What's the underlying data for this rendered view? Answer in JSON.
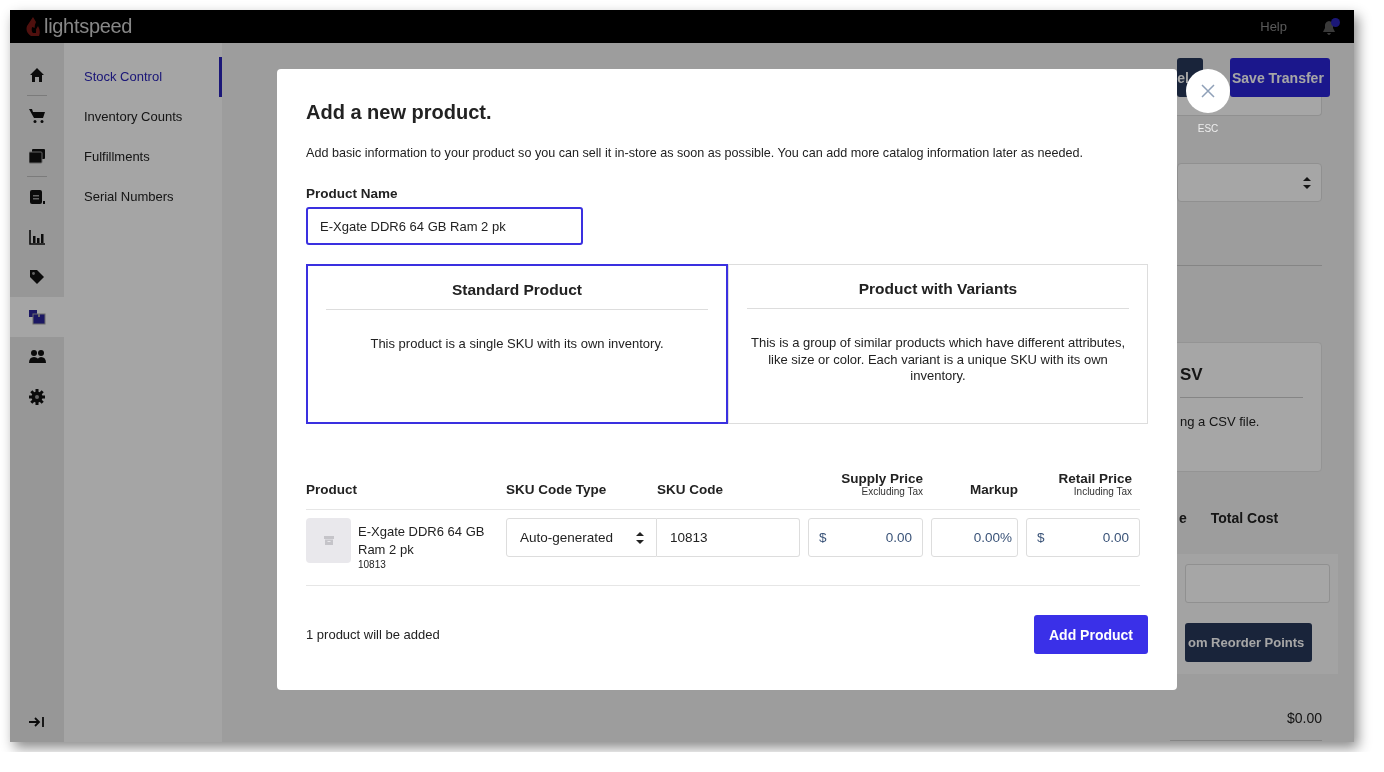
{
  "topbar": {
    "logo": "lightspeed",
    "help": "Help"
  },
  "rail": {
    "items": [
      {
        "selected": false
      },
      {
        "selected": false
      },
      {
        "selected": false
      },
      {
        "selected": false
      },
      {
        "selected": false
      },
      {
        "selected": false
      },
      {
        "selected": true
      },
      {
        "selected": false
      },
      {
        "selected": false
      }
    ]
  },
  "submenu": [
    {
      "label": "Stock Control",
      "selected": true
    },
    {
      "label": "Inventory Counts",
      "selected": false
    },
    {
      "label": "Fulfillments",
      "selected": false
    },
    {
      "label": "Serial Numbers",
      "selected": false
    }
  ],
  "background": {
    "cancel_button": "el",
    "save_button": "Save Transfer",
    "card_title": "SV",
    "card_text": "ng a CSV file.",
    "columns": [
      "e",
      "Total Cost"
    ],
    "reorder_button": "om Reorder Points",
    "total": "$0.00"
  },
  "modal": {
    "title": "Add a new product.",
    "description": "Add basic information to your product so you can sell it in-store as soon as possible. You can add more catalog information later as needed.",
    "product_name": {
      "label": "Product Name",
      "value": "E-Xgate DDR6 64 GB Ram 2 pk"
    },
    "product_types": [
      {
        "title": "Standard Product",
        "description": "This product is a single SKU with its own inventory.",
        "selected": true
      },
      {
        "title": "Product with Variants",
        "description": "This is a group of similar products which have different attributes, like size or color. Each variant is a unique SKU with its own inventory.",
        "selected": false
      }
    ],
    "table": {
      "columns": [
        {
          "label": "Product"
        },
        {
          "label": "SKU Code Type"
        },
        {
          "label": "SKU Code"
        },
        {
          "label": "Supply Price",
          "sublabel": "Excluding Tax"
        },
        {
          "label": "Markup"
        },
        {
          "label": "Retail Price",
          "sublabel": "Including Tax"
        }
      ],
      "rows": [
        {
          "name": "E-Xgate DDR6 64 GB Ram 2 pk",
          "sku": "10813",
          "sku_code_type": "Auto-generated",
          "sku_code": "10813",
          "supply_currency": "$",
          "supply_price": "0.00",
          "markup": "0.00",
          "markup_unit": "%",
          "retail_currency": "$",
          "retail_price": "0.00"
        }
      ]
    },
    "footer": "1 product will be added",
    "add_button": "Add Product",
    "close_label": "ESC"
  }
}
